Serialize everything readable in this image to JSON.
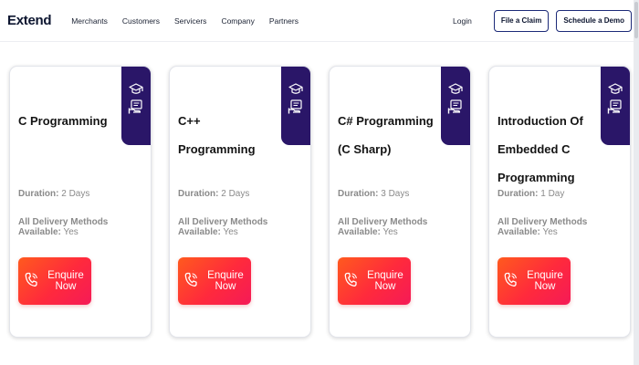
{
  "header": {
    "logo": "Extend",
    "nav": [
      "Merchants",
      "Customers",
      "Servicers",
      "Company",
      "Partners"
    ],
    "login": "Login",
    "file_claim": "File a Claim",
    "schedule_demo": "Schedule a Demo"
  },
  "courses": [
    {
      "title": "C Programming",
      "duration_label": "Duration:",
      "duration": "2 Days",
      "delivery_label": "All Delivery Methods Available:",
      "delivery": "Yes",
      "cta": "Enquire Now"
    },
    {
      "title": "C++ Programming",
      "duration_label": "Duration:",
      "duration": "2 Days",
      "delivery_label": "All Delivery Methods Available:",
      "delivery": "Yes",
      "cta": "Enquire Now"
    },
    {
      "title": "C# Programming (C Sharp)",
      "duration_label": "Duration:",
      "duration": "3 Days",
      "delivery_label": "All Delivery Methods Available:",
      "delivery": "Yes",
      "cta": "Enquire Now"
    },
    {
      "title": "Introduction Of Embedded C Programming",
      "duration_label": "Duration:",
      "duration": "1 Day",
      "delivery_label": "All Delivery Methods Available:",
      "delivery": "Yes",
      "cta": "Enquire Now"
    }
  ],
  "colors": {
    "badge": "#2a1668",
    "cta_start": "#ff5a1e",
    "cta_end": "#f51a57",
    "brand": "#1c2a78"
  },
  "icons": {
    "badge_top": "graduation-cap-icon",
    "badge_bottom": "certificate-hand-icon",
    "cta": "phone-icon"
  }
}
